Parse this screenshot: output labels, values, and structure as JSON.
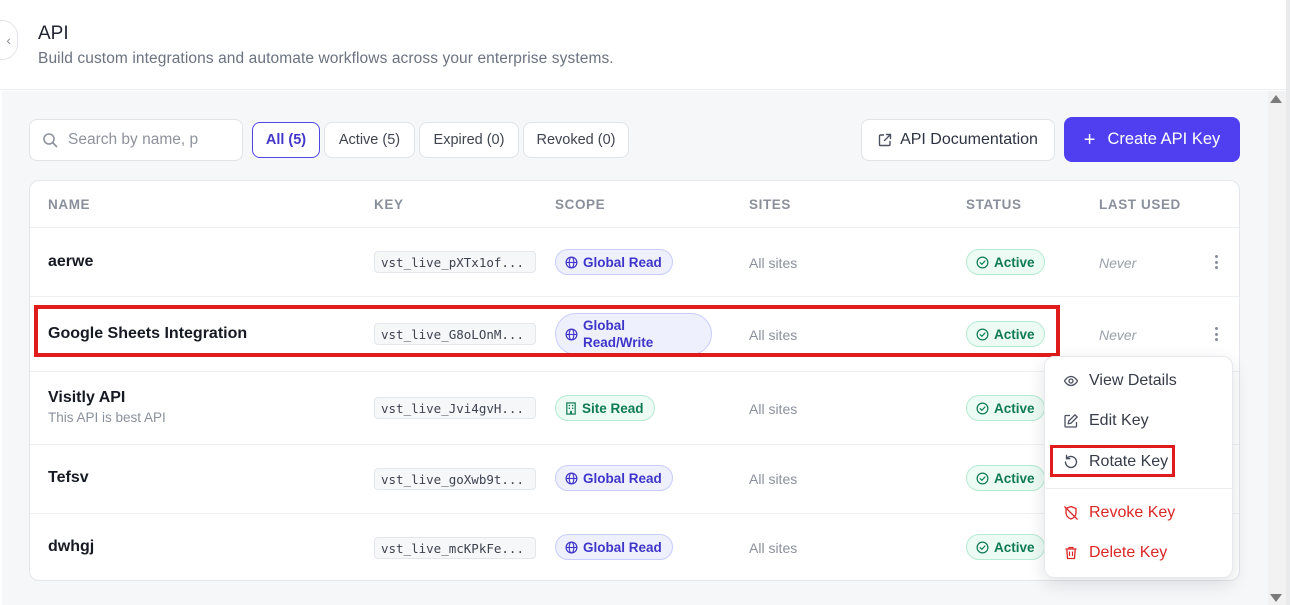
{
  "header": {
    "title": "API",
    "subtitle": "Build custom integrations and automate workflows across your enterprise systems."
  },
  "toolbar": {
    "search_placeholder": "Search by name, p",
    "filters": [
      {
        "label": "All (5)",
        "active": true
      },
      {
        "label": "Active (5)",
        "active": false
      },
      {
        "label": "Expired (0)",
        "active": false
      },
      {
        "label": "Revoked (0)",
        "active": false
      }
    ],
    "docs_label": "API Documentation",
    "create_label": "Create API Key",
    "create_icon": "+"
  },
  "table": {
    "columns": [
      "NAME",
      "KEY",
      "SCOPE",
      "SITES",
      "STATUS",
      "LAST USED"
    ],
    "rows": [
      {
        "name": "aerwe",
        "description": "",
        "key": "vst_live_pXTx1of...",
        "scope": "Global Read",
        "scope_type": "global",
        "sites": "All sites",
        "status": "Active",
        "last_used": "Never"
      },
      {
        "name": "Google Sheets Integration",
        "description": "",
        "key": "vst_live_G8oLOnM...",
        "scope_lines": [
          "Global",
          "Read/Write"
        ],
        "scope_type": "global",
        "sites": "All sites",
        "status": "Active",
        "last_used": "Never"
      },
      {
        "name": "Visitly API",
        "description": "This API is best API",
        "key": "vst_live_Jvi4gvH...",
        "scope": "Site Read",
        "scope_type": "site",
        "sites": "All sites",
        "status": "Active",
        "last_used": ""
      },
      {
        "name": "Tefsv",
        "description": "",
        "key": "vst_live_goXwb9t...",
        "scope": "Global Read",
        "scope_type": "global",
        "sites": "All sites",
        "status": "Active",
        "last_used": ""
      },
      {
        "name": "dwhgj",
        "description": "",
        "key": "vst_live_mcKPkFe...",
        "scope": "Global Read",
        "scope_type": "global",
        "sites": "All sites",
        "status": "Active",
        "last_used": ""
      }
    ]
  },
  "menu": {
    "items": [
      {
        "label": "View Details",
        "icon": "eye-icon"
      },
      {
        "label": "Edit Key",
        "icon": "edit-icon"
      },
      {
        "label": "Rotate Key",
        "icon": "rotate-icon"
      },
      {
        "label": "Revoke Key",
        "icon": "revoke-icon"
      },
      {
        "label": "Delete Key",
        "icon": "trash-icon"
      }
    ]
  },
  "colors": {
    "accent": "#4f3ff0",
    "active_green": "#0f7a55",
    "danger": "#dc2626",
    "highlight": "#e01b1b"
  }
}
